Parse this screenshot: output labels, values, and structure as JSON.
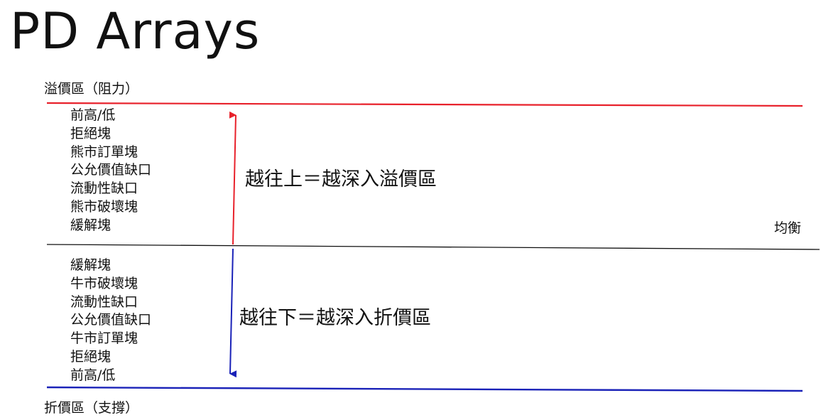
{
  "title": "PD Arrays",
  "premium": {
    "label": "溢價區（阻力）",
    "color": "#e8212b",
    "items": [
      "前高/低",
      "拒絕塊",
      "熊市訂單塊",
      "公允價值缺口",
      "流動性缺口",
      "熊市破壞塊",
      "緩解塊"
    ],
    "statement": "越往上＝越深入溢價區"
  },
  "equilibrium": {
    "label": "均衡",
    "color": "#111111"
  },
  "discount": {
    "label": "折價區（支撐）",
    "color": "#1a22b8",
    "items": [
      "緩解塊",
      "牛市破壞塊",
      "流動性缺口",
      "公允價值缺口",
      "牛市訂單塊",
      "拒絕塊",
      "前高/低"
    ],
    "statement": "越往下＝越深入折價區"
  }
}
